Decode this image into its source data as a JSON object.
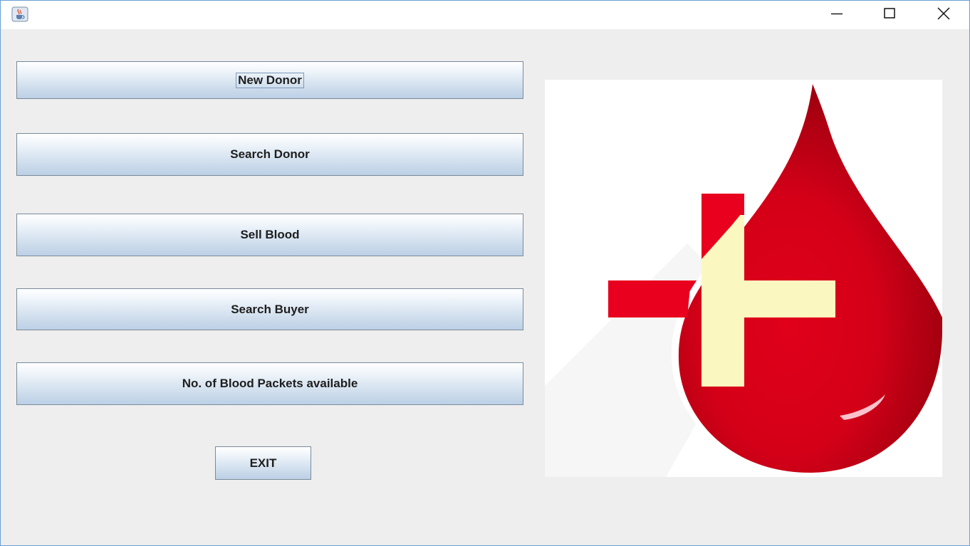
{
  "window": {
    "app_icon": "java-coffee-icon",
    "controls": {
      "minimize_icon": "minimize-icon",
      "maximize_icon": "maximize-icon",
      "close_icon": "close-icon"
    }
  },
  "menu": {
    "new_donor": "New Donor",
    "search_donor": "Search Donor",
    "sell_blood": "Sell Blood",
    "search_buyer": "Search Buyer",
    "blood_packets": "No. of Blood Packets available",
    "exit": "EXIT"
  },
  "logo": {
    "icon": "blood-drop-plus-icon",
    "drop_color": "#d40018",
    "cross_red_color": "#e8001e",
    "cross_cream_color": "#fbf7c0"
  }
}
